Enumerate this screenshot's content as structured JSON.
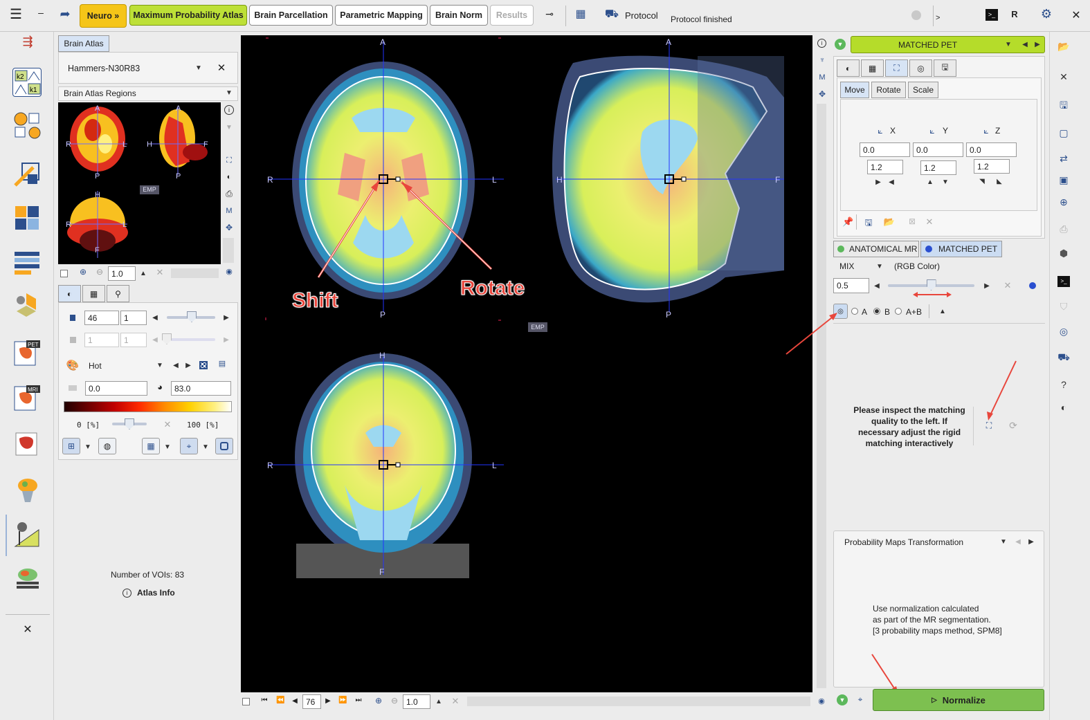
{
  "toolbar": {
    "neuro": "Neuro »",
    "tabs": [
      "Maximum Probability Atlas",
      "Brain Parcellation",
      "Parametric Mapping",
      "Brain Norm",
      "Results"
    ],
    "protocol": "Protocol",
    "status": "Protocol finished",
    "r_label": "R",
    "prompt": ">"
  },
  "left_panel": {
    "tab": "Brain Atlas",
    "atlas": "Hammers-N30R83",
    "regions_select": "Brain Atlas Regions",
    "emp": "EMP",
    "zoom": "1.0",
    "slice": "46",
    "slice_step": "1",
    "disabled_a": "1",
    "disabled_b": "1",
    "colormap": "Hot",
    "min": "0.0",
    "max": "83.0",
    "pct_min": "0  [%]",
    "pct_max": "100  [%]",
    "voi_count": "Number of VOIs: 83",
    "atlas_info": "Atlas Info",
    "orient": {
      "A": "A",
      "P": "P",
      "R": "R",
      "L": "L",
      "H": "H",
      "F": "F"
    }
  },
  "viewer": {
    "labels": {
      "A": "A",
      "P": "P",
      "R": "R",
      "L": "L",
      "H": "H",
      "F": "F"
    },
    "emp": "EMP",
    "shift": "Shift",
    "rotate": "Rotate",
    "slice": "76",
    "zoom": "1.0"
  },
  "right_panel": {
    "series": "MATCHED PET",
    "tabs": [
      "Move",
      "Rotate",
      "Scale"
    ],
    "axes": [
      "X",
      "Y",
      "Z"
    ],
    "offsets": [
      "0.0",
      "0.0",
      "0.0"
    ],
    "steps": [
      "1.2",
      "1.2",
      "1.2"
    ],
    "image_tabs": [
      "ANATOMICAL MR",
      "MATCHED PET"
    ],
    "mix": "MIX",
    "mix_mode": "(RGB Color)",
    "mix_value": "0.5",
    "mix_level": 0.5,
    "radio": [
      "A",
      "B",
      "A+B"
    ],
    "message": "Please inspect the matching quality to the left. If necessary adjust the rigid matching interactively",
    "transform_title": "Probability Maps Transformation",
    "transform_text_1": "Use normalization calculated",
    "transform_text_2": "as part of the MR segmentation.",
    "transform_text_3": "[3 probability maps method, SPM8]",
    "normalize": "Normalize"
  },
  "colors": {
    "neuro": "#f5c518",
    "active_tab": "#bde037",
    "matched": "#b5dc2a",
    "normalize": "#7dc050",
    "annotation": "#e8463c"
  }
}
